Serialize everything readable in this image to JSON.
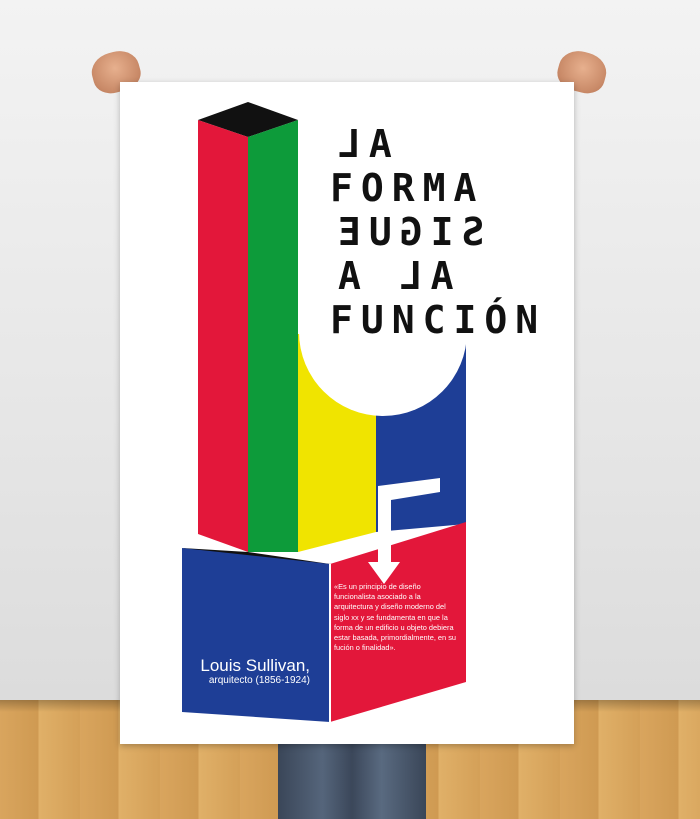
{
  "poster": {
    "headline": [
      "AL",
      "FORMA",
      "SIGUE",
      "AL A",
      "FUNCIÓN"
    ],
    "quote": "«Es un principio de diseño funcionalista asociado a la arquitectura y diseño moderno del siglo xx y se fundamenta en que la forma de un edificio u objeto debiera estar basada, primordialmente, en su fución o finalidad».",
    "author_name": "Louis Sullivan,",
    "author_role": "arquitecto (1856-1924)"
  },
  "colors": {
    "red": "#e3173a",
    "green": "#0d9b3a",
    "yellow": "#f0e400",
    "blue": "#1e3e96",
    "black": "#111111"
  }
}
